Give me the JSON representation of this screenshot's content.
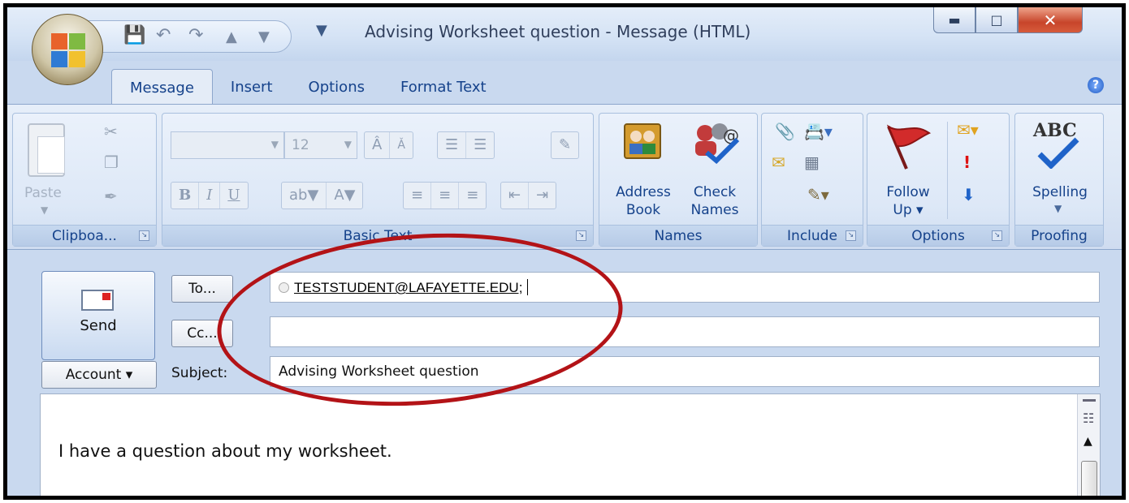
{
  "window": {
    "title": "Advising Worksheet question - Message (HTML)",
    "minimize_icon": "minimize-icon",
    "maximize_icon": "maximize-icon",
    "close_icon": "close-icon"
  },
  "quick_access": {
    "icons": [
      "save-icon",
      "undo-icon",
      "redo-icon",
      "previous-item-icon",
      "next-item-icon",
      "customize-toolbar-icon"
    ]
  },
  "tabs": [
    {
      "label": "Message",
      "active": true
    },
    {
      "label": "Insert",
      "active": false
    },
    {
      "label": "Options",
      "active": false
    },
    {
      "label": "Format Text",
      "active": false
    }
  ],
  "ribbon": {
    "clipboard": {
      "group_label": "Clipboa...",
      "paste_label": "Paste"
    },
    "basic_text": {
      "group_label": "Basic Text",
      "font_size": "12"
    },
    "names": {
      "group_label": "Names",
      "address_book_line1": "Address",
      "address_book_line2": "Book",
      "check_names_line1": "Check",
      "check_names_line2": "Names"
    },
    "include": {
      "group_label": "Include"
    },
    "options": {
      "group_label": "Options",
      "follow_up_line1": "Follow",
      "follow_up_line2": "Up ▾"
    },
    "proofing": {
      "group_label": "Proofing",
      "spelling_label": "Spelling",
      "spelling_icon_text": "ABC"
    }
  },
  "header": {
    "send_label": "Send",
    "to_label": "To...",
    "cc_label": "Cc...",
    "account_label": "Account ▾",
    "subject_label": "Subject:",
    "to_value": "TESTSTUDENT@LAFAYETTE.EDU;",
    "cc_value": "",
    "subject_value": "Advising Worksheet question"
  },
  "body": {
    "text": "I have a question about my worksheet."
  },
  "colors": {
    "accent": "#15428b",
    "annotation": "#b31317",
    "close_button": "#c8452a"
  }
}
